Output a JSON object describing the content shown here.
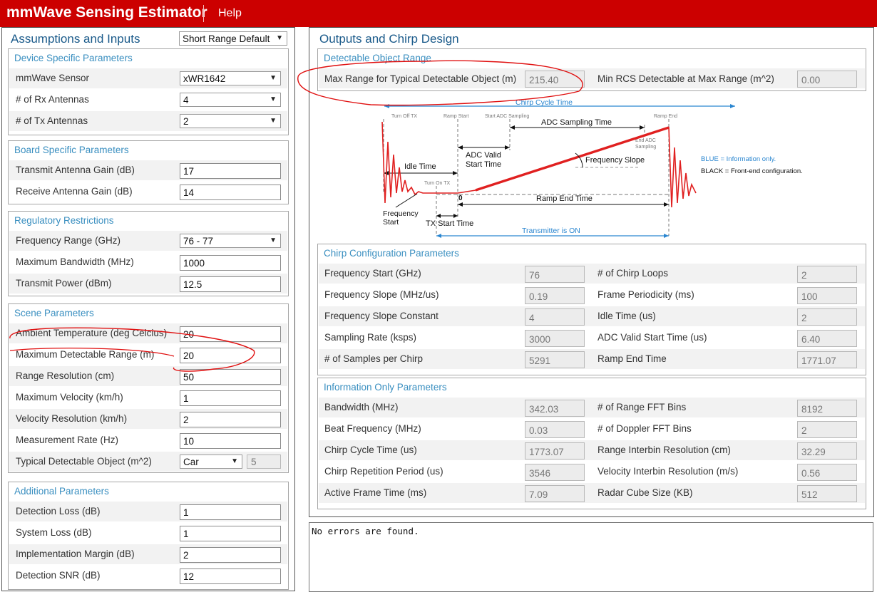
{
  "header": {
    "title": "mmWave Sensing Estimator",
    "help": "Help"
  },
  "left": {
    "title": "Assumptions and Inputs",
    "preset": "Short Range Default",
    "device": {
      "title": "Device Specific Parameters",
      "sensor_label": "mmWave Sensor",
      "sensor_value": "xWR1642",
      "rx_label": "# of Rx Antennas",
      "rx_value": "4",
      "tx_label": "# of Tx Antennas",
      "tx_value": "2"
    },
    "board": {
      "title": "Board Specific Parameters",
      "tx_gain_label": "Transmit Antenna Gain (dB)",
      "tx_gain_value": "17",
      "rx_gain_label": "Receive Antenna Gain (dB)",
      "rx_gain_value": "14"
    },
    "regulatory": {
      "title": "Regulatory Restrictions",
      "freq_label": "Frequency Range (GHz)",
      "freq_value": "76 - 77",
      "bw_label": "Maximum Bandwidth (MHz)",
      "bw_value": "1000",
      "power_label": "Transmit Power (dBm)",
      "power_value": "12.5"
    },
    "scene": {
      "title": "Scene Parameters",
      "temp_label": "Ambient Temperature (deg Celcius)",
      "temp_value": "20",
      "range_label": "Maximum Detectable Range (m)",
      "range_value": "20",
      "res_label": "Range Resolution (cm)",
      "res_value": "50",
      "vel_label": "Maximum Velocity (km/h)",
      "vel_value": "1",
      "velres_label": "Velocity Resolution (km/h)",
      "velres_value": "2",
      "rate_label": "Measurement Rate (Hz)",
      "rate_value": "10",
      "obj_label": "Typical Detectable Object (m^2)",
      "obj_value": "Car",
      "obj_rcs": "5"
    },
    "additional": {
      "title": "Additional Parameters",
      "det_loss_label": "Detection Loss (dB)",
      "det_loss_value": "1",
      "sys_loss_label": "System Loss (dB)",
      "sys_loss_value": "1",
      "impl_label": "Implementation Margin (dB)",
      "impl_value": "2",
      "snr_label": "Detection SNR (dB)",
      "snr_value": "12"
    }
  },
  "right": {
    "title": "Outputs and Chirp Design",
    "detectable": {
      "title": "Detectable Object Range",
      "max_range_label": "Max Range for Typical Detectable Object (m)",
      "max_range_value": "215.40",
      "min_rcs_label": "Min RCS Detectable at Max Range (m^2)",
      "min_rcs_value": "0.00"
    },
    "diagram": {
      "chirp_cycle": "Chirp Cycle Time",
      "turn_off_tx": "Turn Off TX",
      "ramp_start": "Ramp Start",
      "start_adc": "Start ADC Sampling",
      "ramp_end": "Ramp End",
      "adc_sampling_time": "ADC Sampling Time",
      "end_adc_1": "End ADC",
      "end_adc_2": "Sampling",
      "adc_valid_1": "ADC Valid",
      "adc_valid_2": "Start Time",
      "idle_time": "Idle Time",
      "freq_slope": "Frequency Slope",
      "blue_note": "BLUE = Information only.",
      "black_note": "BLACK = Front-end configuration.",
      "turn_on_tx": "Turn On TX",
      "zero": "0",
      "ramp_end_time": "Ramp End Time",
      "freq_start_1": "Frequency",
      "freq_start_2": "Start",
      "tx_start": "TX Start Time",
      "tx_on": "Transmitter is ON"
    },
    "chirp": {
      "title": "Chirp Configuration Parameters",
      "freq_start_label": "Frequency Start (GHz)",
      "freq_start_value": "76",
      "chirp_loops_label": "# of Chirp Loops",
      "chirp_loops_value": "2",
      "slope_label": "Frequency Slope (MHz/us)",
      "slope_value": "0.19",
      "frame_label": "Frame Periodicity (ms)",
      "frame_value": "100",
      "slope_const_label": "Frequency Slope Constant",
      "slope_const_value": "4",
      "idle_label": "Idle Time (us)",
      "idle_value": "2",
      "sampling_label": "Sampling Rate (ksps)",
      "sampling_value": "3000",
      "adc_start_label": "ADC Valid Start Time (us)",
      "adc_start_value": "6.40",
      "samples_label": "# of Samples per Chirp",
      "samples_value": "5291",
      "ramp_end_label": "Ramp End Time",
      "ramp_end_value": "1771.07"
    },
    "info": {
      "title": "Information Only Parameters",
      "bw_label": "Bandwidth (MHz)",
      "bw_value": "342.03",
      "range_bins_label": "# of Range FFT Bins",
      "range_bins_value": "8192",
      "beat_label": "Beat Frequency (MHz)",
      "beat_value": "0.03",
      "doppler_bins_label": "# of Doppler FFT Bins",
      "doppler_bins_value": "2",
      "cycle_label": "Chirp Cycle Time (us)",
      "cycle_value": "1773.07",
      "interbin_label": "Range Interbin Resolution (cm)",
      "interbin_value": "32.29",
      "rep_label": "Chirp Repetition Period (us)",
      "rep_value": "3546",
      "vel_interbin_label": "Velocity Interbin Resolution (m/s)",
      "vel_interbin_value": "0.56",
      "active_label": "Active Frame Time (ms)",
      "active_value": "7.09",
      "cube_label": "Radar Cube Size (KB)",
      "cube_value": "512"
    },
    "status": "No errors are found."
  }
}
